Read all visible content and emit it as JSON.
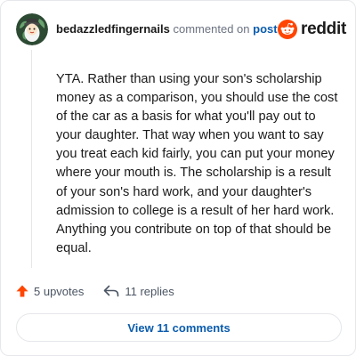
{
  "comment": {
    "author": "bedazzledfingernails",
    "action_text": "commented on",
    "post_link": "post",
    "body": "YTA. Rather than using your son's scholarship money as a comparison, you should use the cost of the car as a basis for what you'll pay out to your daughter. That way when you want to say you treat each kid fairly, you can put your money where your mouth is. The scholarship is a result of your son's hard work, and your daughter's admission to college is a result of her hard work. Anything you contribute on top of that should be equal."
  },
  "brand": {
    "name": "reddit",
    "accent": "#ff4500"
  },
  "actions": {
    "upvotes": "5 upvotes",
    "replies": "11 replies",
    "upvote_color": "#ff4500"
  },
  "footer": {
    "view_comments": "View 11 comments",
    "link_color": "#0b5cad"
  },
  "icons": {
    "avatar": "user-avatar",
    "logo": "reddit-logo-icon",
    "upvote": "upvote-arrow-icon",
    "reply": "reply-arrow-icon"
  }
}
